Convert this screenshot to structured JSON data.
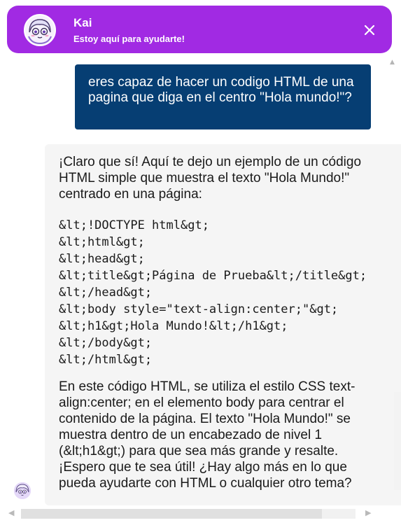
{
  "header": {
    "title": "Kai",
    "subtitle": "Estoy aquí para ayudarte!",
    "close_symbol": "✕",
    "avatar_icon": "anime-avatar-icon",
    "background_color": "#a12ae3"
  },
  "messages": {
    "user": {
      "text": "eres capaz de hacer un codigo HTML de una pagina que diga en el centro \"Hola mundo!\"?",
      "background_color": "#063e73"
    },
    "bot": {
      "intro_lines": [
        "¡Claro que sí! Aquí te dejo un ejemplo de un código",
        "HTML simple que muestra el texto \"Hola Mundo!\"",
        "centrado en una página:"
      ],
      "code_lines": [
        "&lt;!DOCTYPE html&gt;",
        "&lt;html&gt;",
        "&lt;head&gt;",
        "&lt;title&gt;Página de Prueba&lt;/title&gt;",
        "&lt;/head&gt;",
        "&lt;body style=\"text-align:center;\"&gt;",
        "&lt;h1&gt;Hola Mundo!&lt;/h1&gt;",
        "&lt;/body&gt;",
        "&lt;/html&gt;"
      ],
      "outro_lines": [
        "En este código HTML, se utiliza el estilo CSS text-",
        "align:center; en el elemento body para centrar el",
        "contenido de la página. El texto \"Hola Mundo!\" se",
        "muestra dentro de un encabezado de nivel 1",
        "(&lt;h1&gt;) para que sea más grande y resalte.",
        "¡Espero que te sea útil! ¿Hay algo más en lo que",
        "pueda ayudarte con HTML o cualquier otro tema?"
      ],
      "background_color": "#f5f5f5"
    }
  },
  "scrollbar": {
    "left_arrow": "◀",
    "right_arrow": "▶",
    "up_arrow": "▲"
  }
}
